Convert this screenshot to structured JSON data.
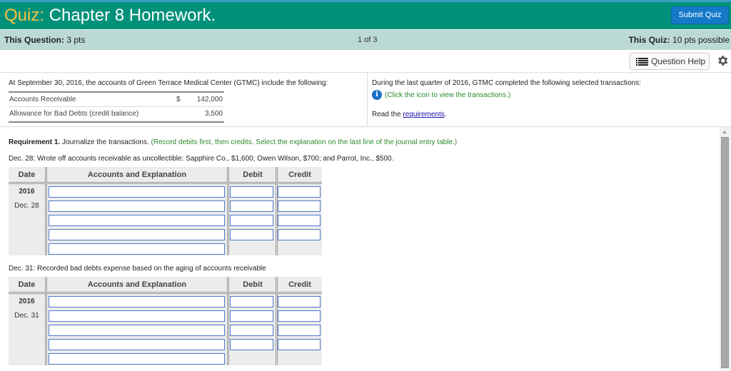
{
  "header": {
    "quiz_label": "Quiz:",
    "title": "Chapter 8 Homework.",
    "submit_label": "Submit Quiz",
    "colors": {
      "header_bg": "#00917a",
      "quiz_word": "#f5c342",
      "submit_bg": "#1479c9",
      "infobar_bg": "#bbd9d5"
    }
  },
  "infobar": {
    "question_label": "This Question:",
    "question_pts": "3 pts",
    "position": "1 of 3",
    "quiz_label": "This Quiz:",
    "quiz_pts": "10 pts possible"
  },
  "toolbar": {
    "help_label": "Question Help",
    "help_icon": "list-icon",
    "settings_icon": "gear-icon"
  },
  "left_panel": {
    "intro": "At September 30, 2016, the accounts of Green Terrace Medical Center (GTMC) include the following:",
    "accounts": [
      {
        "name": "Accounts Receivable",
        "currency": "$",
        "amount": "142,000"
      },
      {
        "name": "Allowance for Bad Debts (credit balance)",
        "currency": "",
        "amount": "3,500"
      }
    ]
  },
  "right_panel": {
    "line1": "During the last quarter of 2016, GTMC completed the following selected transactions:",
    "info_icon": "info-icon",
    "line2": "(Click the icon to view the transactions.)",
    "line3_prefix": "Read the ",
    "requirements_link": "requirements",
    "line3_suffix": "."
  },
  "requirement": {
    "label": "Requirement 1.",
    "text": " Journalize the transactions. ",
    "hint": "(Record debits first, then credits. Select the explanation on the last line of the journal entry table.)"
  },
  "journals": [
    {
      "description": "Dec. 28: Wrote off accounts receivable as uncollectible: Sapphire Co., $1,600; Owen Wilson, $700; and Parrot, Inc., $500.",
      "headers": {
        "date": "Date",
        "accounts": "Accounts and Explanation",
        "debit": "Debit",
        "credit": "Credit"
      },
      "year": "2016",
      "date": "Dec. 28",
      "rows": [
        {
          "account": "",
          "debit": "",
          "credit": ""
        },
        {
          "account": "",
          "debit": "",
          "credit": ""
        },
        {
          "account": "",
          "debit": "",
          "credit": ""
        },
        {
          "account": "",
          "debit": "",
          "credit": ""
        }
      ],
      "explanation": ""
    },
    {
      "description": "Dec. 31: Recorded bad debts expense based on the aging of accounts receivable",
      "headers": {
        "date": "Date",
        "accounts": "Accounts and Explanation",
        "debit": "Debit",
        "credit": "Credit"
      },
      "year": "2016",
      "date": "Dec. 31",
      "rows": [
        {
          "account": "",
          "debit": "",
          "credit": ""
        },
        {
          "account": "",
          "debit": "",
          "credit": ""
        },
        {
          "account": "",
          "debit": "",
          "credit": ""
        },
        {
          "account": "",
          "debit": "",
          "credit": ""
        }
      ],
      "explanation": ""
    }
  ]
}
